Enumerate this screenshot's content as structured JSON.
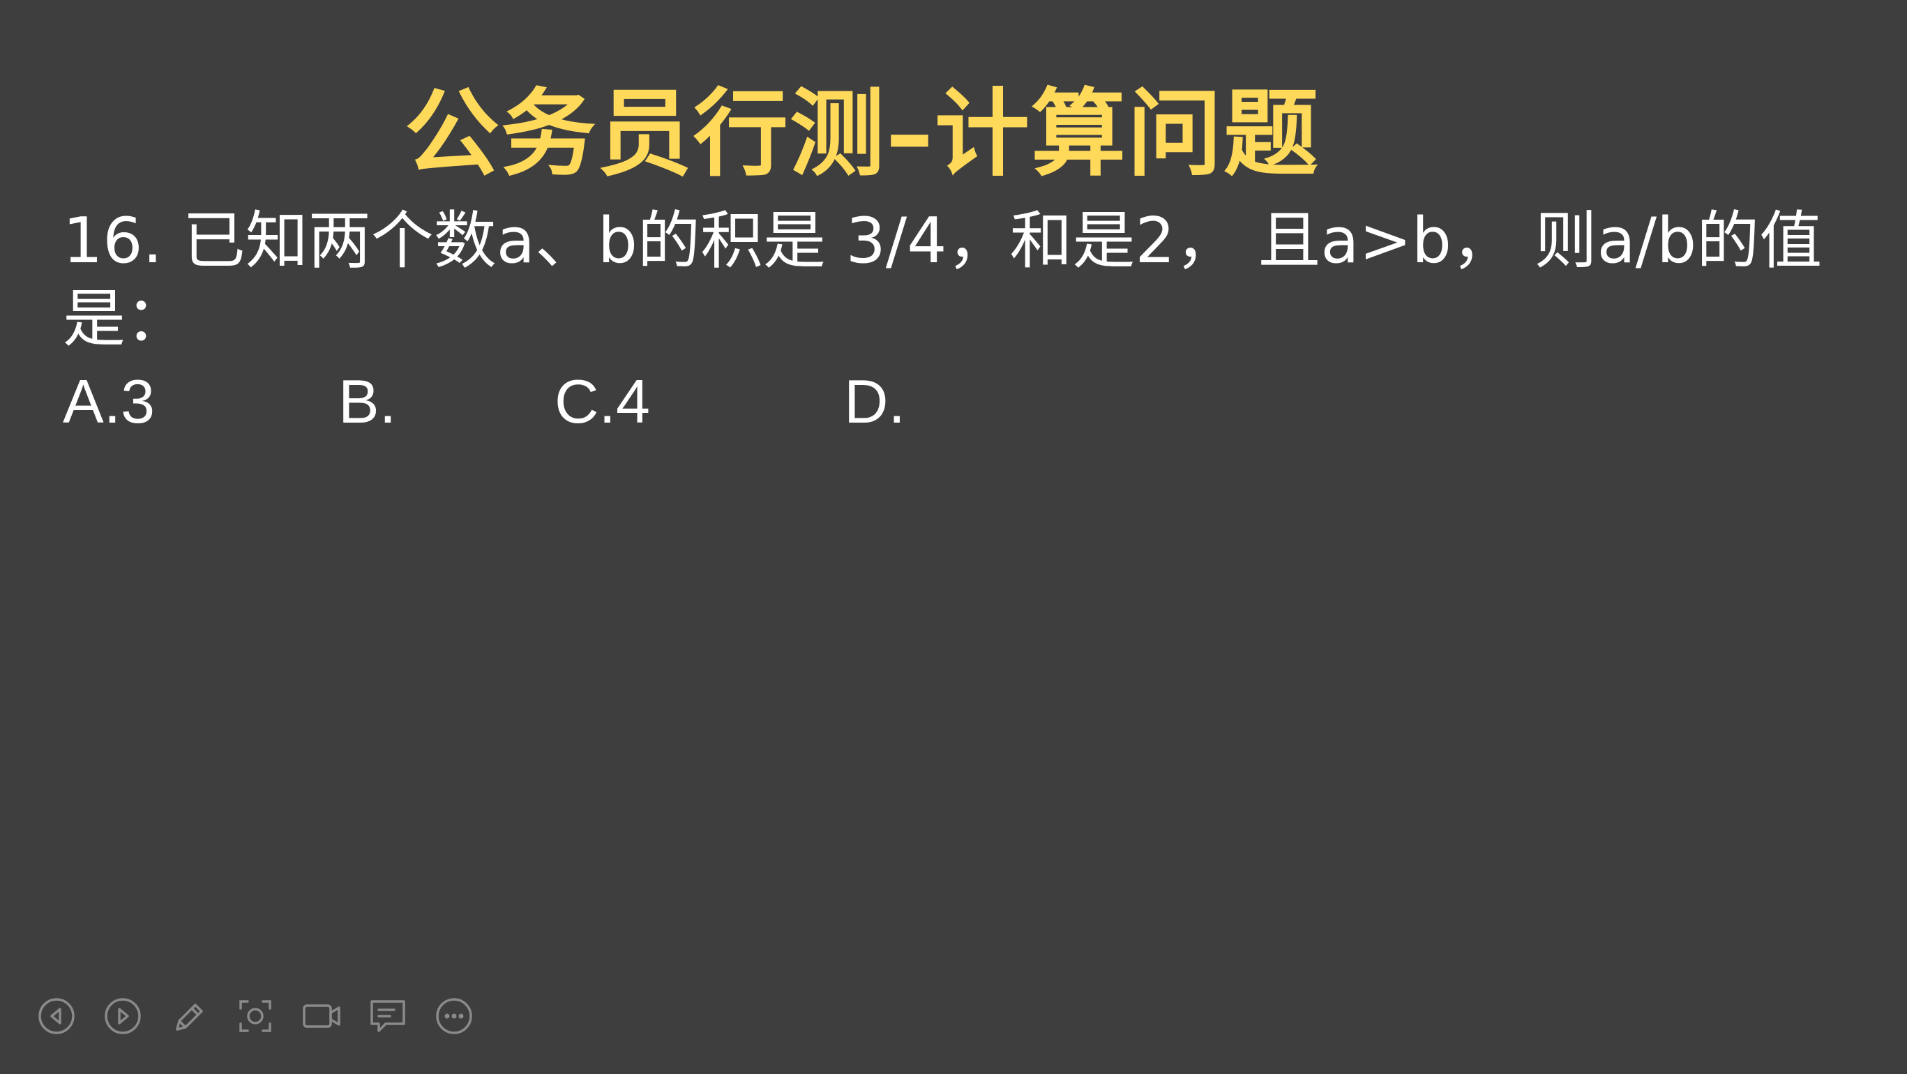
{
  "slide": {
    "title": "公务员行测–计算问题",
    "question": "16. 已知两个数a、b的积是 3/4，和是2， 且a>b， 则a/b的值是：",
    "options": [
      {
        "label": "A.3"
      },
      {
        "label": "B."
      },
      {
        "label": "C.4"
      },
      {
        "label": "D."
      }
    ]
  },
  "toolbar": {
    "icons": [
      "previous-icon",
      "next-icon",
      "pen-icon",
      "screenshot-icon",
      "camera-icon",
      "comment-icon",
      "more-icon"
    ]
  },
  "colors": {
    "background": "#3e3e3e",
    "title": "#ffd95a",
    "text": "#ffffff",
    "toolbar_icon": "#8a8a8a"
  }
}
